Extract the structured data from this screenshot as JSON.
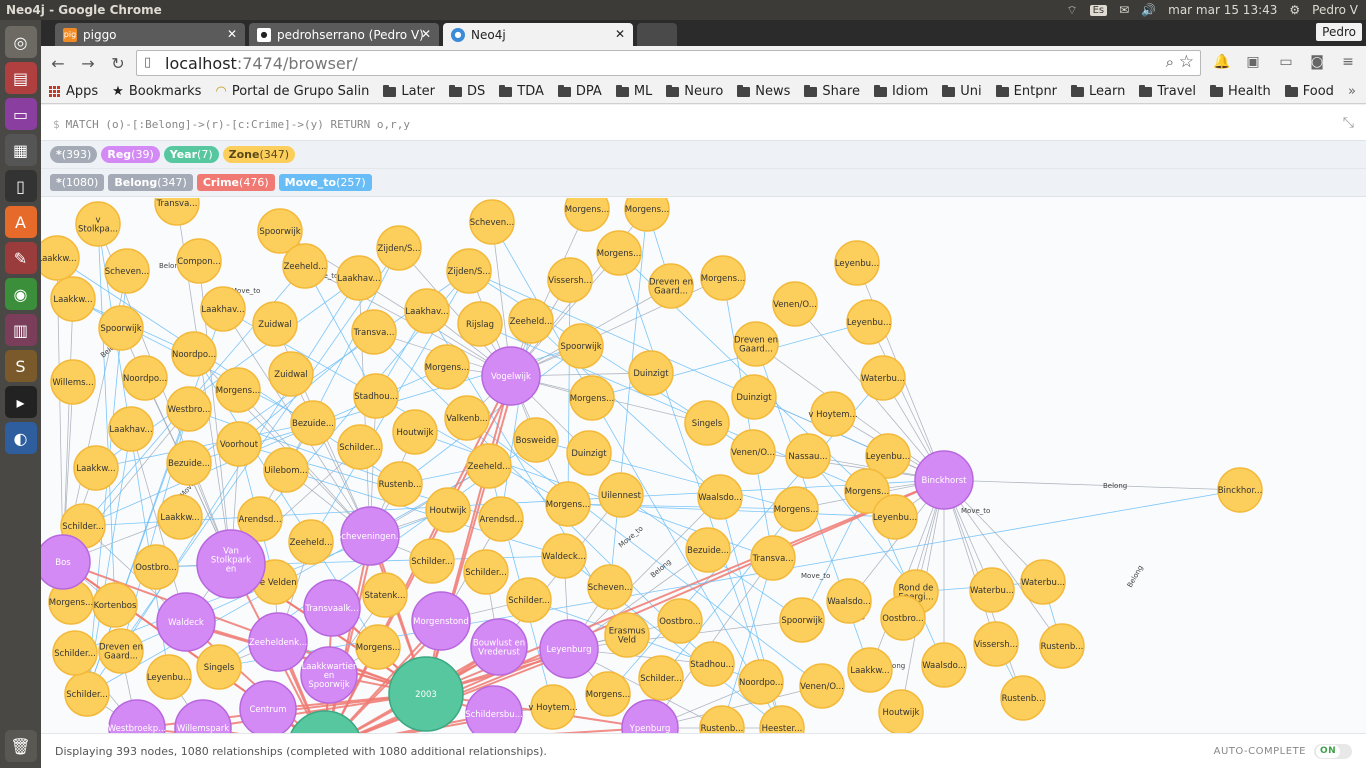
{
  "os": {
    "window_title": "Neo4j - Google Chrome",
    "keyboard_layout": "Es",
    "datetime": "mar mar 15 13:43",
    "user": "Pedro V"
  },
  "browser": {
    "tabs": [
      {
        "label": "piggo",
        "icon": "pig-icon",
        "active": false
      },
      {
        "label": "pedrohserrano (Pedro V)",
        "icon": "github-icon",
        "active": false
      },
      {
        "label": "Neo4j",
        "icon": "neo4j-icon",
        "active": true
      }
    ],
    "profile": "Pedro",
    "url_host": "localhost",
    "url_rest": ":7474/browser/",
    "bookmarks": [
      "Apps",
      "Bookmarks",
      "Portal de Grupo Salin",
      "Later",
      "DS",
      "TDA",
      "DPA",
      "ML",
      "Neuro",
      "News",
      "Share",
      "Idiom",
      "Uni",
      "Entpnr",
      "Learn",
      "Travel",
      "Health",
      "Food"
    ]
  },
  "neo4j": {
    "query_prompt": "$",
    "query": "MATCH (o)-[:Belong]->(r)-[c:Crime]->(y) RETURN o,r,y",
    "labels": [
      {
        "name": "*",
        "count": "(393)",
        "color": "#a5abb6"
      },
      {
        "name": "Reg",
        "count": "(39)",
        "color": "#d48af5"
      },
      {
        "name": "Year",
        "count": "(7)",
        "color": "#57c7a0"
      },
      {
        "name": "Zone",
        "count": "(347)",
        "color": "#fccf5c",
        "dark_text": true
      }
    ],
    "relationships": [
      {
        "name": "*",
        "count": "(1080)",
        "color": "#a5abb6"
      },
      {
        "name": "Belong",
        "count": "(347)",
        "color": "#a5abb6"
      },
      {
        "name": "Crime",
        "count": "(476)",
        "color": "#f07a73"
      },
      {
        "name": "Move_to",
        "count": "(257)",
        "color": "#68bdf6"
      }
    ],
    "status": "Displaying 393 nodes, 1080 relationships (completed with 1080 additional relationships).",
    "autocomplete_label": "AUTO-COMPLETE",
    "autocomplete_state": "ON",
    "colors": {
      "zone": "#fccf5c",
      "zone_border": "#f3b93a",
      "reg": "#d48af5",
      "reg_border": "#b868dd",
      "year": "#57c7a0",
      "year_border": "#3ba882",
      "belong_edge": "#a5abb6",
      "crime_edge": "#f07a73",
      "move_edge": "#68bdf6"
    }
  },
  "graph": {
    "zone_nodes": [
      "Transva...",
      "v Stolkpa...",
      "Spoorwijk",
      "Scheven...",
      "Compon...",
      "Zeeheld...",
      "Laakhav...",
      "Zijden/S...",
      "Morgens...",
      "Morgens...",
      "Leyenbu...",
      "Scheven...",
      "Laakkw...",
      "Laakhav...",
      "Zuidwal",
      "Zijden/S...",
      "Vissersh...",
      "Dreven en Gaard...",
      "Morgens...",
      "Venen/O...",
      "Leyenbu...",
      "Spoorwijk",
      "Noordpo...",
      "Laakhav...",
      "Rijslag",
      "Zeeheld...",
      "Morgens...",
      "Dreven en Gaard...",
      "Willems...",
      "Noordpo...",
      "Morgens...",
      "Zuidwal",
      "Transva...",
      "Spoorwijk",
      "Duinzigt",
      "Waterbu...",
      "Westbro...",
      "Stadhou...",
      "Morgens...",
      "Morgens...",
      "Duinzigt",
      "v Hoytem...",
      "Laakhav...",
      "Voorhout",
      "Bezuide...",
      "Valkenb...",
      "Singels",
      "Nassau...",
      "Leyenbu...",
      "Bezuide...",
      "Schilder...",
      "Houtwijk",
      "Bosweide",
      "Duinzigt",
      "Venen/O...",
      "Laakkw...",
      "Uilebom...",
      "Rustenb...",
      "Zeeheld...",
      "Uilennest",
      "Waalsdo...",
      "Morgens...",
      "Morgens...",
      "Laakkw...",
      "Arendsd...",
      "Houtwijk",
      "Arendsd...",
      "Morgens...",
      "Leyenbu...",
      "Schilder...",
      "Zeeheld...",
      "Schilder...",
      "Waldeck...",
      "Bezuide...",
      "Transva...",
      "Schilder...",
      "Oostbro...",
      "De Velden",
      "Schilder...",
      "Scheven...",
      "Rond de Energi...",
      "Waterbu...",
      "Waterbu...",
      "Kortenbos",
      "Statenk...",
      "Oostbro...",
      "Waalsdo...",
      "Oostbro...",
      "Spoorwijk",
      "Dreven en Gaard...",
      "Morgens...",
      "Erasmus Veld",
      "Vissersh...",
      "Rustenb...",
      "Singels",
      "Stadhou...",
      "Laakkw...",
      "Waalsdo...",
      "Leyenbu...",
      "Schilder...",
      "Noordpo...",
      "Venen/O...",
      "Schilder...",
      "v Hoytem...",
      "Morgens...",
      "Houtwijk",
      "Rustenb...",
      "Rustenb...",
      "Heester...",
      "Schilder...",
      "Morgens...",
      "Laakkw...",
      "Scheven..."
    ],
    "reg_nodes": [
      "Vogelwijk",
      "Binckhorst",
      "Scheveningen...",
      "Van Stolkpark en Scheveni...",
      "Waldeck",
      "Transvaalk...",
      "Zeeheldenk...",
      "Morgenstond",
      "Bouwlust en Vrederust",
      "Leyenburg",
      "Laakkwartier en Spoorwijk",
      "Centrum",
      "Willemspark",
      "Schildersbu...",
      "Westbroekp...",
      "Ypenburg",
      "Bos"
    ],
    "year_nodes": [
      "2003",
      ""
    ],
    "isolated": [
      "Binckhor..."
    ],
    "edge_labels": [
      "Belong",
      "Move_to",
      "Crime"
    ]
  }
}
